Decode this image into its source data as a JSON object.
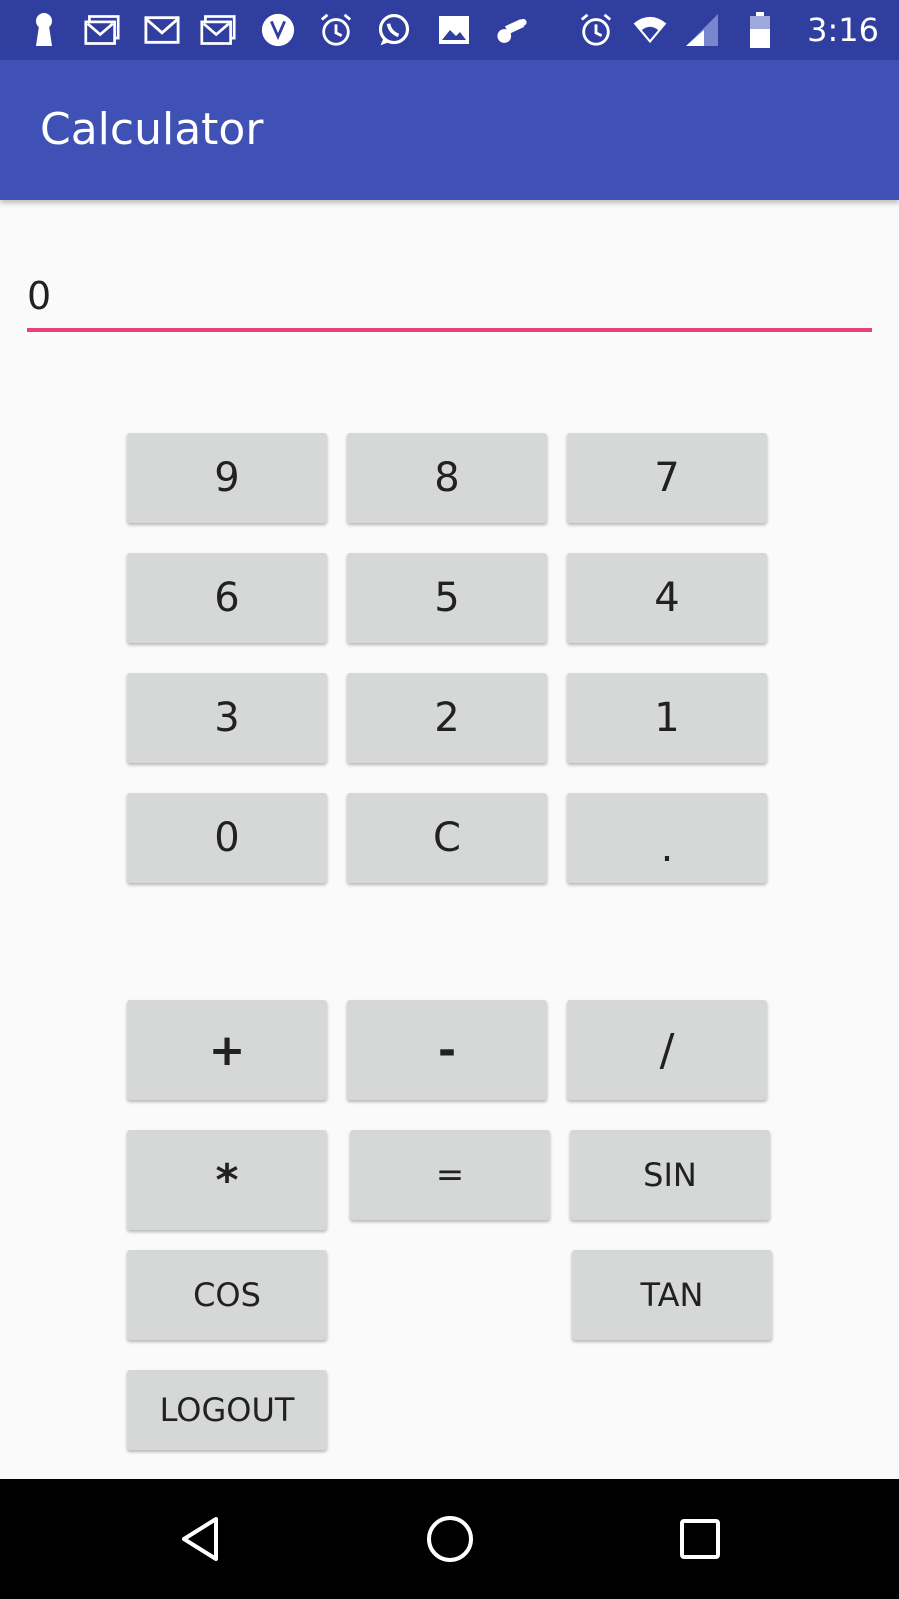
{
  "status_bar": {
    "time": "3:16",
    "icons": [
      "keyhole-icon",
      "gallery-mail-icon",
      "gmail-icon",
      "gallery-mail-icon-2",
      "vpn-icon",
      "alarm-icon",
      "whatsapp-icon",
      "image-icon",
      "settings-bug-icon",
      "alarm-icon-2",
      "wifi-icon",
      "signal-icon",
      "battery-icon"
    ]
  },
  "app_bar": {
    "title": "Calculator"
  },
  "display": {
    "value": "0",
    "accent_color": "#ec407a"
  },
  "keypad": {
    "digits": {
      "row1": [
        "9",
        "8",
        "7"
      ],
      "row2": [
        "6",
        "5",
        "4"
      ],
      "row3": [
        "3",
        "2",
        "1"
      ],
      "row4": [
        "0",
        "C",
        "."
      ]
    },
    "operators": {
      "plus": "+",
      "minus": "-",
      "divide": "/",
      "multiply": "*",
      "equals": "=",
      "sin": "SIN",
      "cos": "COS",
      "tan": "TAN",
      "logout": "LOGOUT"
    }
  },
  "nav_bar": {
    "buttons": [
      "back-icon",
      "home-icon",
      "recents-icon"
    ]
  },
  "colors": {
    "status_bar": "#303f9f",
    "app_bar": "#3f51b5",
    "button": "#d6d7d7",
    "background": "#fafafa"
  }
}
